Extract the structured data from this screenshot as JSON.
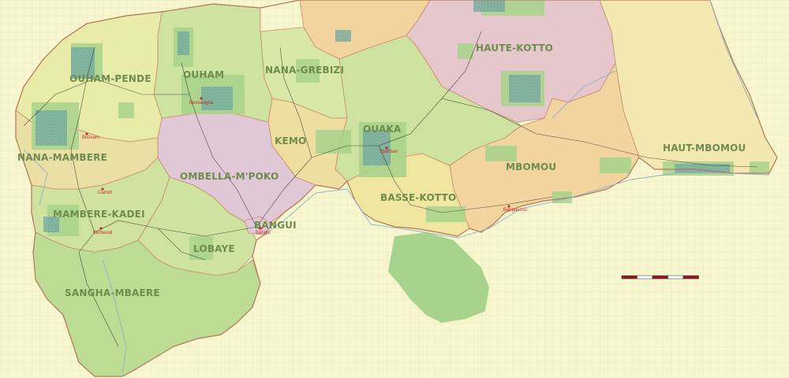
{
  "map": {
    "colors": {
      "outside": "#f7f6cf",
      "grid": "#e3e2b4",
      "border": "#c88a6a",
      "river": "#8fb0c8",
      "road": "#2a2a2a",
      "forest": "#a8d38c",
      "forest_dark": "#5fa0a0"
    },
    "regions": [
      {
        "id": "ombella-mpoko",
        "label": "OMBELLA-M'POKO",
        "fill": "#e0c8d6"
      },
      {
        "id": "haute-kotto",
        "label": "HAUTE-KOTTO",
        "fill": "#e6c8cc"
      },
      {
        "id": "ouham",
        "label": "OUHAM",
        "fill": "#cfe3a0"
      },
      {
        "id": "ouham-pende",
        "label": "OUHAM-PENDE",
        "fill": "#e8eca8"
      },
      {
        "id": "nana-grebizi",
        "label": "NANA-GREBIZI",
        "fill": "#d8e8a8"
      },
      {
        "id": "ouaka",
        "label": "OUAKA",
        "fill": "#cfe3a0"
      },
      {
        "id": "kemo",
        "label": "KEMO",
        "fill": "#eedfa0"
      },
      {
        "id": "nana-mambere",
        "label": "NANA-MAMBERE",
        "fill": "#eae0a6"
      },
      {
        "id": "mambere-kadei",
        "label": "MAMBERE-KADEI",
        "fill": "#cfe2a0"
      },
      {
        "id": "lobaye",
        "label": "LOBAYE",
        "fill": "#cfe3a0"
      },
      {
        "id": "bangui",
        "label": "BANGUI",
        "fill": "#e0c8d6"
      },
      {
        "id": "basse-kotto",
        "label": "BASSE-KOTTO",
        "fill": "#f0e6a0"
      },
      {
        "id": "mbomou",
        "label": "MBOMOU",
        "fill": "#f2d49e"
      },
      {
        "id": "haut-mbomou",
        "label": "HAUT-MBOMOU",
        "fill": "#f4e8b2"
      },
      {
        "id": "sangha-mbaere",
        "label": "SANGHA-MBAERE",
        "fill": "#bedd94"
      },
      {
        "id": "vakaga-south",
        "label": "",
        "fill": "#f2d49e"
      }
    ],
    "cities": [
      {
        "id": "bossangoa",
        "label": "Bossangoa"
      },
      {
        "id": "bozoum",
        "label": "Bozoum"
      },
      {
        "id": "carnot",
        "label": "Carnot"
      },
      {
        "id": "berberati",
        "label": "Berberati"
      },
      {
        "id": "bangui",
        "label": "Bangui"
      },
      {
        "id": "bambari",
        "label": "Bambari"
      },
      {
        "id": "bangassou",
        "label": "Bangassou"
      }
    ],
    "scale_bar": {
      "segments": 5
    }
  }
}
